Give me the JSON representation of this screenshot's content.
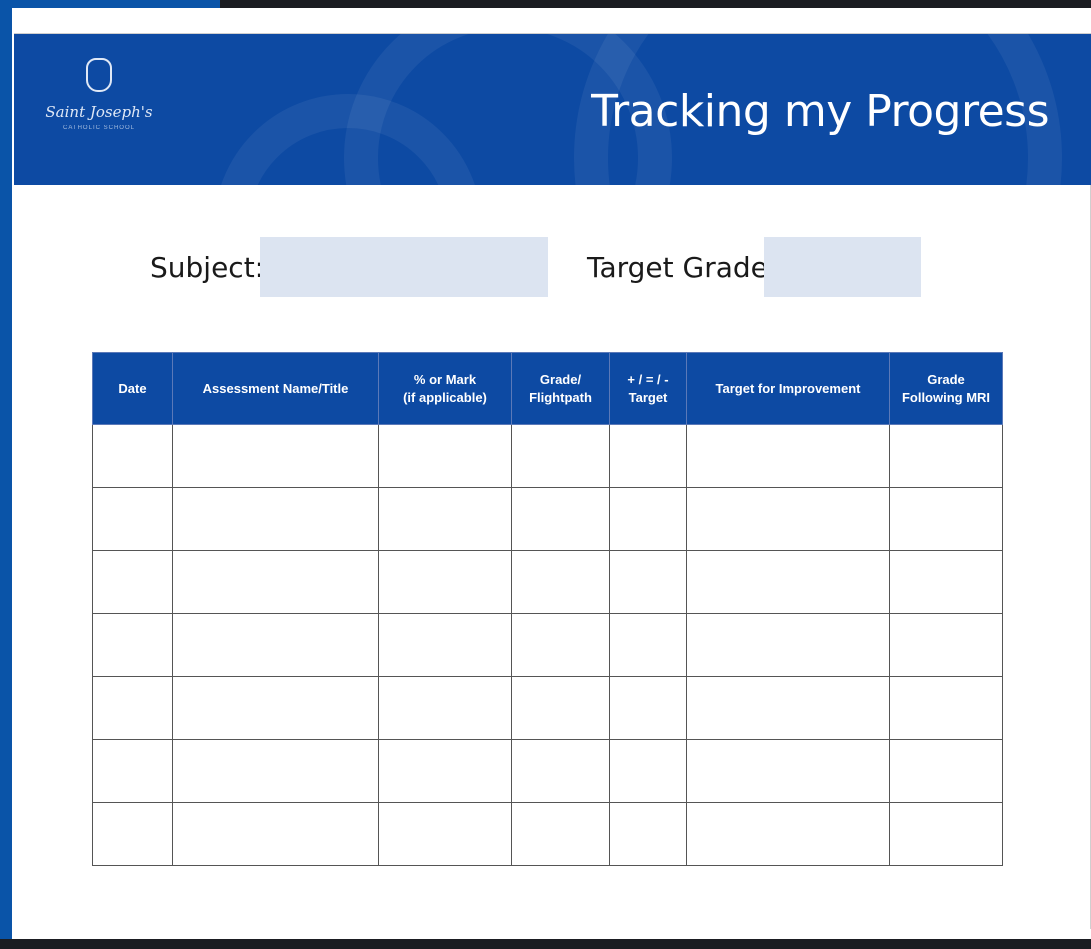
{
  "header": {
    "school_name": "Saint Joseph's",
    "school_subtitle": "CATHOLIC SCHOOL",
    "title": "Tracking my Progress"
  },
  "form": {
    "subject_label": "Subject:",
    "subject_value": "",
    "target_grade_label": "Target Grade:",
    "target_grade_value": ""
  },
  "table": {
    "columns": [
      "Date",
      "Assessment Name/Title",
      "% or Mark\n(if applicable)",
      "Grade/\nFlightpath",
      "+ / = / -\nTarget",
      "Target for Improvement",
      "Grade\nFollowing MRI"
    ],
    "rows": [
      [
        "",
        "",
        "",
        "",
        "",
        "",
        ""
      ],
      [
        "",
        "",
        "",
        "",
        "",
        "",
        ""
      ],
      [
        "",
        "",
        "",
        "",
        "",
        "",
        ""
      ],
      [
        "",
        "",
        "",
        "",
        "",
        "",
        ""
      ],
      [
        "",
        "",
        "",
        "",
        "",
        "",
        ""
      ],
      [
        "",
        "",
        "",
        "",
        "",
        "",
        ""
      ],
      [
        "",
        "",
        "",
        "",
        "",
        "",
        ""
      ]
    ]
  },
  "colors": {
    "brand_blue": "#0d4aa3",
    "input_fill": "#dce4f1",
    "frame_dark": "#1b1d22"
  }
}
